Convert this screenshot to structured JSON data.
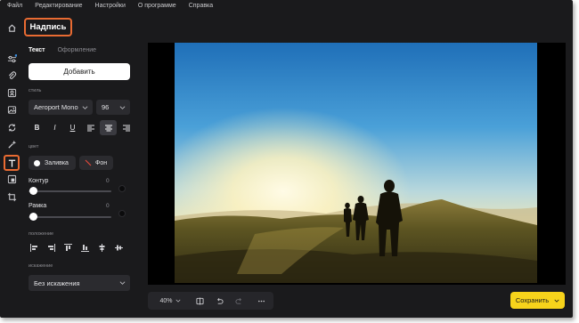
{
  "menu": [
    "Файл",
    "Редактирование",
    "Настройки",
    "О программе",
    "Справка"
  ],
  "tools": [
    {
      "name": "home-icon"
    },
    {
      "name": "adjust-icon"
    },
    {
      "name": "clip-icon"
    },
    {
      "name": "retouch-icon"
    },
    {
      "name": "image-icon"
    },
    {
      "name": "replace-icon"
    },
    {
      "name": "magic-icon"
    },
    {
      "name": "text-icon",
      "active": true
    },
    {
      "name": "frame-icon"
    },
    {
      "name": "crop-icon"
    }
  ],
  "panel_title": "Надпись",
  "tabs": {
    "text": "Текст",
    "design": "Оформление"
  },
  "add_button": "Добавить",
  "style_label": "стиль",
  "font": {
    "family": "Aeroport Mono",
    "size": "96"
  },
  "text_buttons": {
    "bold": "B",
    "italic": "I",
    "underline": "U"
  },
  "color_label": "цвет",
  "fill_button": "Заливка",
  "background_button": "Фон",
  "outline": {
    "label": "Контур",
    "value": "0"
  },
  "frame": {
    "label": "Рамка",
    "value": "0"
  },
  "position_label": "положение",
  "distortion_label": "искажение",
  "distortion_value": "Без искажения",
  "zoom": "40%",
  "save_button": "Сохранить",
  "colors": {
    "accent": "#e96b32",
    "save": "#f7d31b",
    "background": "#1a1a1c"
  }
}
